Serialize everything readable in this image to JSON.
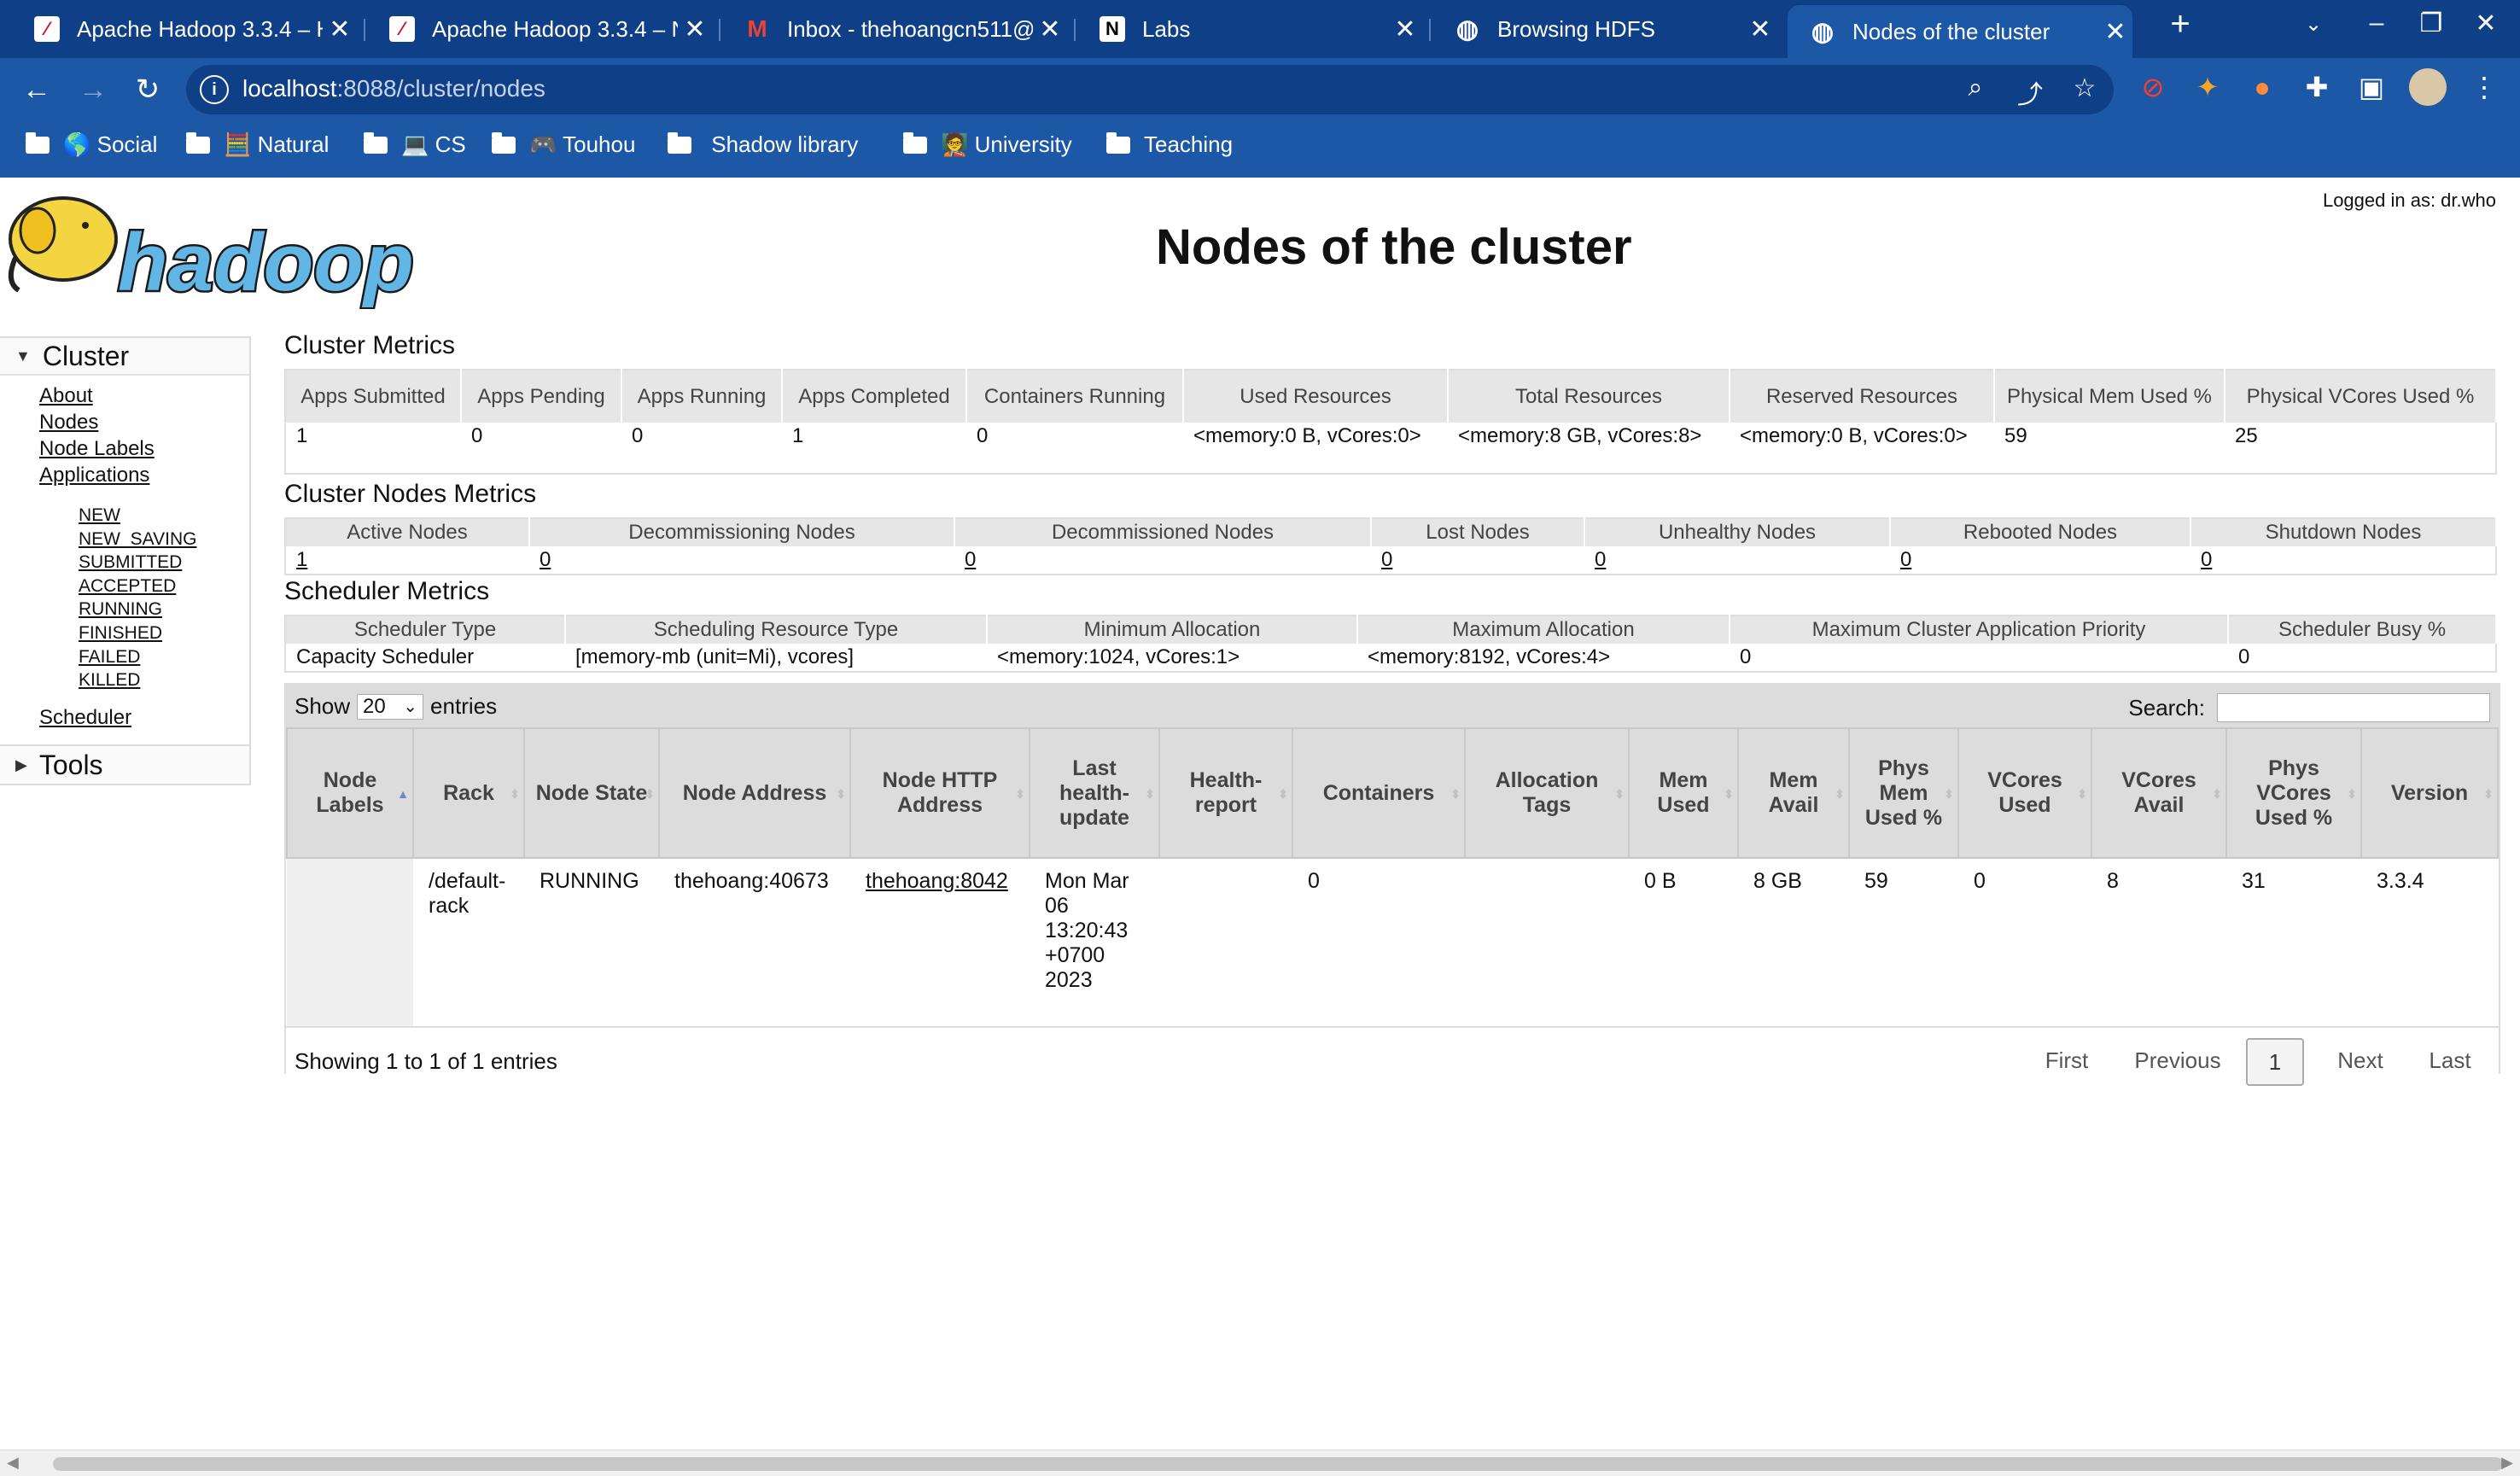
{
  "browser": {
    "tabs": [
      {
        "title": "Apache Hadoop 3.3.4 – H",
        "icon": "hadoop-tab-icon"
      },
      {
        "title": "Apache Hadoop 3.3.4 – N",
        "icon": "hadoop-tab-icon"
      },
      {
        "title": "Inbox - thehoangcn511@",
        "icon": "gmail-icon"
      },
      {
        "title": "Labs",
        "icon": "notion-icon"
      },
      {
        "title": "Browsing HDFS",
        "icon": "globe-icon"
      },
      {
        "title": "Nodes of the cluster",
        "icon": "globe-icon"
      }
    ],
    "active_tab": 5,
    "url_host": "localhost",
    "url_rest": ":8088/cluster/nodes",
    "bookmarks": [
      {
        "label": "🌎 Social"
      },
      {
        "label": "🧮 Natural"
      },
      {
        "label": "💻 CS"
      },
      {
        "label": "🎮 Touhou"
      },
      {
        "label": " Shadow library"
      },
      {
        "label": "🧑‍🏫 University"
      },
      {
        "label": "Teaching"
      }
    ]
  },
  "header": {
    "logged_in": "Logged in as: dr.who",
    "title": "Nodes of the cluster",
    "logo_text": "hadoop"
  },
  "sidebar": {
    "cluster_label": "Cluster",
    "links": [
      "About",
      "Nodes",
      "Node Labels",
      "Applications"
    ],
    "app_states": [
      "NEW",
      "NEW_SAVING",
      "SUBMITTED",
      "ACCEPTED",
      "RUNNING",
      "FINISHED",
      "FAILED",
      "KILLED"
    ],
    "scheduler": "Scheduler",
    "tools_label": "Tools"
  },
  "cluster_metrics": {
    "title": "Cluster Metrics",
    "headers": [
      "Apps Submitted",
      "Apps Pending",
      "Apps Running",
      "Apps Completed",
      "Containers Running",
      "Used Resources",
      "Total Resources",
      "Reserved Resources",
      "Physical Mem Used %",
      "Physical VCores Used %"
    ],
    "values": [
      "1",
      "0",
      "0",
      "1",
      "0",
      "<memory:0 B, vCores:0>",
      "<memory:8 GB, vCores:8>",
      "<memory:0 B, vCores:0>",
      "59",
      "25"
    ]
  },
  "node_metrics": {
    "title": "Cluster Nodes Metrics",
    "headers": [
      "Active Nodes",
      "Decommissioning Nodes",
      "Decommissioned Nodes",
      "Lost Nodes",
      "Unhealthy Nodes",
      "Rebooted Nodes",
      "Shutdown Nodes"
    ],
    "values": [
      "1",
      "0",
      "0",
      "0",
      "0",
      "0",
      "0"
    ]
  },
  "scheduler_metrics": {
    "title": "Scheduler Metrics",
    "headers": [
      "Scheduler Type",
      "Scheduling Resource Type",
      "Minimum Allocation",
      "Maximum Allocation",
      "Maximum Cluster Application Priority",
      "Scheduler Busy %"
    ],
    "values": [
      "Capacity Scheduler",
      "[memory-mb (unit=Mi), vcores]",
      "<memory:1024, vCores:1>",
      "<memory:8192, vCores:4>",
      "0",
      "0"
    ]
  },
  "nodes_table": {
    "show_label": "Show",
    "page_size": "20",
    "entries_label": "entries",
    "search_label": "Search:",
    "headers": [
      "Node Labels",
      "Rack",
      "Node State",
      "Node Address",
      "Node HTTP Address",
      "Last health-update",
      "Health-report",
      "Containers",
      "Allocation Tags",
      "Mem Used",
      "Mem Avail",
      "Phys Mem Used %",
      "VCores Used",
      "VCores Avail",
      "Phys VCores Used %",
      "Version"
    ],
    "rows": [
      [
        "",
        "/default-rack",
        "RUNNING",
        "thehoang:40673",
        "thehoang:8042",
        "Mon Mar 06 13:20:43 +0700 2023",
        "",
        "0",
        "",
        "0 B",
        "8 GB",
        "59",
        "0",
        "8",
        "31",
        "3.3.4"
      ]
    ],
    "info": "Showing 1 to 1 of 1 entries",
    "pagination": {
      "first": "First",
      "previous": "Previous",
      "current": "1",
      "next": "Next",
      "last": "Last"
    }
  }
}
